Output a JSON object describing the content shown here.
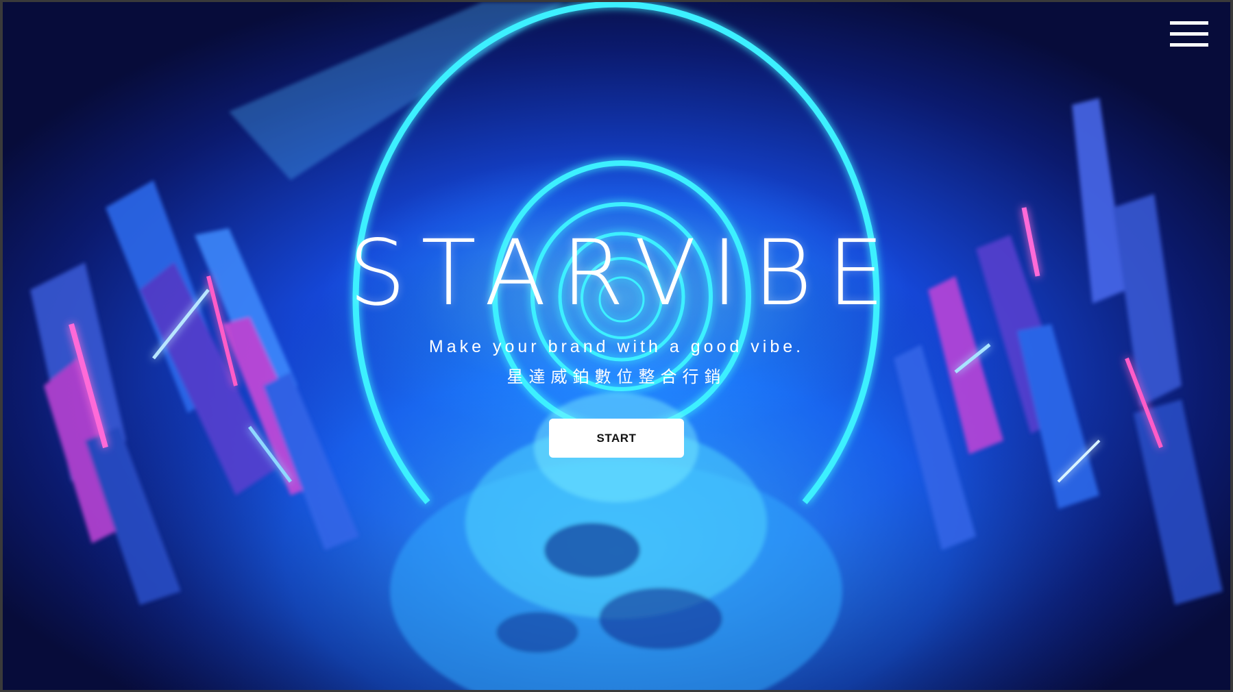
{
  "brand": {
    "logo_text": "STARVIBE",
    "tagline": "Make your brand with a good vibe.",
    "tagline_zh": "星達威鉑數位整合行銷"
  },
  "hero": {
    "cta_label": "START",
    "background": "neon-ring-tunnel-video"
  },
  "nav": {
    "menu_icon": "hamburger-menu-icon"
  },
  "colors": {
    "neon_cyan": "#3ef0ff",
    "deep_blue": "#0b1a6e",
    "accent_pink": "#ff4fd8",
    "button_bg": "#ffffff",
    "button_text": "#111111"
  }
}
